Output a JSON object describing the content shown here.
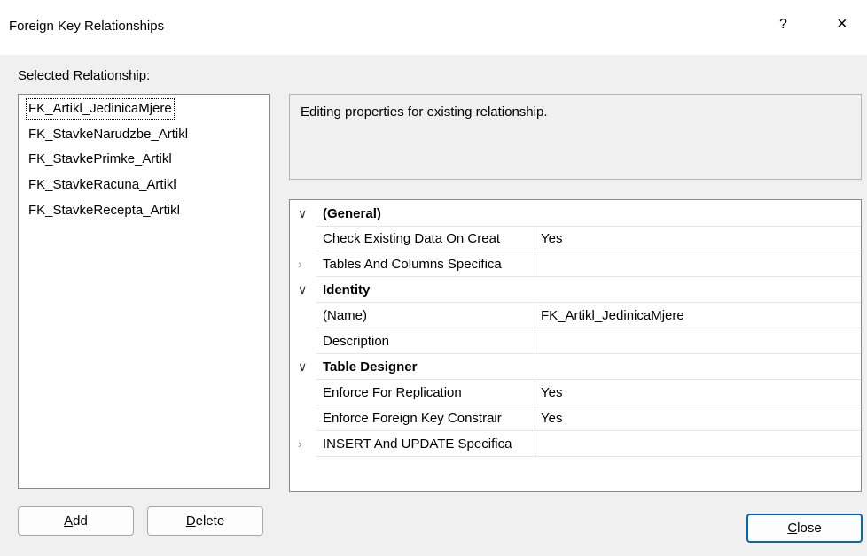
{
  "window": {
    "title": "Foreign Key Relationships",
    "help_label": "?",
    "close_glyph": "×"
  },
  "selected_relationship": {
    "label_prefix_underlined": "S",
    "label_rest": "elected Relationship:",
    "items": [
      "FK_Artikl_JedinicaMjere",
      "FK_StavkeNarudzbe_Artikl",
      "FK_StavkePrimke_Artikl",
      "FK_StavkeRacuna_Artikl",
      "FK_StavkeRecepta_Artikl"
    ],
    "selected_index": 0
  },
  "description": "Editing properties for existing relationship.",
  "properties": {
    "general": {
      "category": "(General)",
      "check_existing_name": "Check Existing Data On Creat",
      "check_existing_value": "Yes",
      "tables_columns_name": "Tables And Columns Specifica",
      "tables_columns_value": ""
    },
    "identity": {
      "category": "Identity",
      "name_name": "(Name)",
      "name_value": "FK_Artikl_JedinicaMjere",
      "description_name": "Description",
      "description_value": ""
    },
    "table_designer": {
      "category": "Table Designer",
      "enforce_replication_name": "Enforce For Replication",
      "enforce_replication_value": "Yes",
      "enforce_fk_name": "Enforce Foreign Key Constrair",
      "enforce_fk_value": "Yes",
      "insert_update_name": "INSERT And UPDATE Specifica",
      "insert_update_value": ""
    },
    "expanded_glyph": "∨",
    "collapsed_glyph": "›"
  },
  "buttons": {
    "add_mnemonic": "A",
    "add_rest": "dd",
    "delete_mnemonic": "D",
    "delete_rest": "elete",
    "close_mnemonic": "C",
    "close_rest": "lose"
  }
}
